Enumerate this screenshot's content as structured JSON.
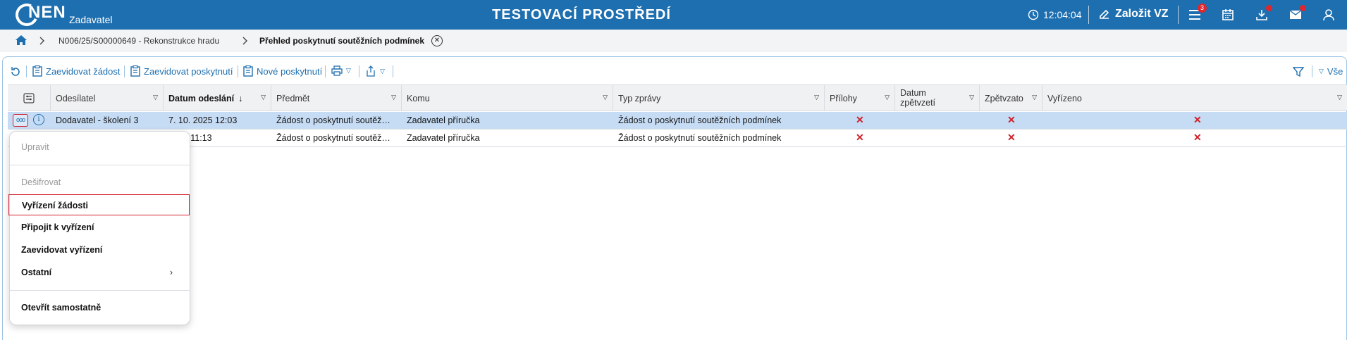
{
  "topbar": {
    "logo_text": "NEN",
    "role": "Zadavatel",
    "environment": "TESTOVACÍ PROSTŘEDÍ",
    "time": "12:04:04",
    "create_label": "Založit VZ",
    "menu_badge": "3",
    "background_color": "#1e6fb0"
  },
  "breadcrumb": {
    "items": [
      {
        "label": "N006/25/S00000649 - Rekonstrukce hradu"
      },
      {
        "label": "Přehled poskytnutí soutěžních podmínek"
      }
    ]
  },
  "toolbar": {
    "evidence_request": "Zaevidovat žádost",
    "evidence_provided": "Zaevidovat poskytnutí",
    "new_provided": "Nové poskytnutí",
    "all_label": "Vše"
  },
  "table": {
    "columns": [
      "Odesílatel",
      "Datum odeslání",
      "Předmět",
      "Komu",
      "Typ zprávy",
      "Přílohy",
      "Datum zpětvzetí",
      "Zpětvzato",
      "Vyřízeno"
    ],
    "sort_indicator": "↓",
    "rows": [
      {
        "sender": "Dodavatel - školení 3",
        "date": "7. 10. 2025 12:03",
        "subject": "Žádost o poskytnutí soutěž…",
        "to": "Zadavatel příručka",
        "type": "Žádost o poskytnutí soutěžních podmínek",
        "attachments": "✕",
        "withdrawn": "✕",
        "resolved": "✕"
      },
      {
        "sender": "",
        "date": "2025 11:13",
        "subject": "Žádost o poskytnutí soutěž…",
        "to": "Zadavatel příručka",
        "type": "Žádost o poskytnutí soutěžních podmínek",
        "attachments": "✕",
        "withdrawn": "✕",
        "resolved": "✕"
      }
    ]
  },
  "context_menu": {
    "edit": "Upravit",
    "decrypt": "Dešifrovat",
    "resolve_request": "Vyřízení žádosti",
    "attach_to_resolution": "Připojit k vyřízení",
    "register_resolution": "Zaevidovat vyřízení",
    "other": "Ostatní",
    "open_separately": "Otevřít samostatně"
  }
}
